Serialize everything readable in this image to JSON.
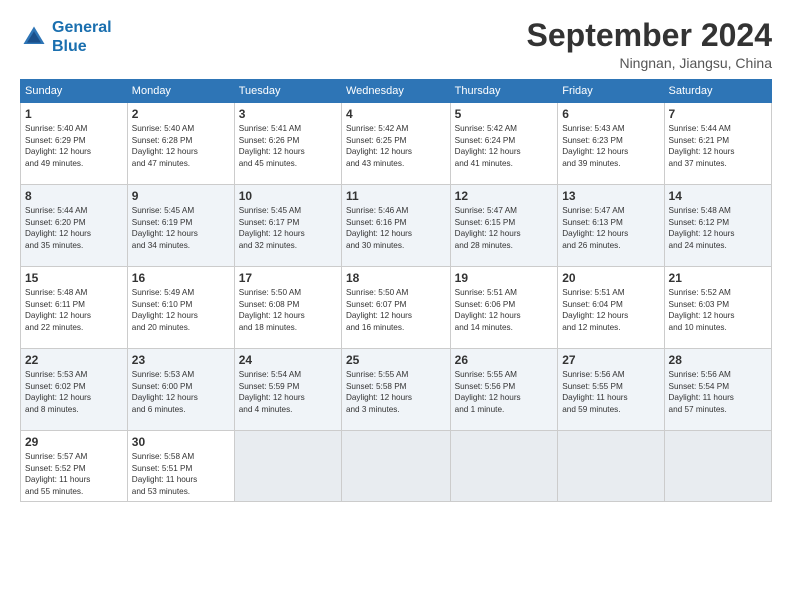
{
  "header": {
    "logo_line1": "General",
    "logo_line2": "Blue",
    "month_title": "September 2024",
    "location": "Ningnan, Jiangsu, China"
  },
  "weekdays": [
    "Sunday",
    "Monday",
    "Tuesday",
    "Wednesday",
    "Thursday",
    "Friday",
    "Saturday"
  ],
  "weeks": [
    [
      {
        "day": "1",
        "info": "Sunrise: 5:40 AM\nSunset: 6:29 PM\nDaylight: 12 hours\nand 49 minutes."
      },
      {
        "day": "2",
        "info": "Sunrise: 5:40 AM\nSunset: 6:28 PM\nDaylight: 12 hours\nand 47 minutes."
      },
      {
        "day": "3",
        "info": "Sunrise: 5:41 AM\nSunset: 6:26 PM\nDaylight: 12 hours\nand 45 minutes."
      },
      {
        "day": "4",
        "info": "Sunrise: 5:42 AM\nSunset: 6:25 PM\nDaylight: 12 hours\nand 43 minutes."
      },
      {
        "day": "5",
        "info": "Sunrise: 5:42 AM\nSunset: 6:24 PM\nDaylight: 12 hours\nand 41 minutes."
      },
      {
        "day": "6",
        "info": "Sunrise: 5:43 AM\nSunset: 6:23 PM\nDaylight: 12 hours\nand 39 minutes."
      },
      {
        "day": "7",
        "info": "Sunrise: 5:44 AM\nSunset: 6:21 PM\nDaylight: 12 hours\nand 37 minutes."
      }
    ],
    [
      {
        "day": "8",
        "info": "Sunrise: 5:44 AM\nSunset: 6:20 PM\nDaylight: 12 hours\nand 35 minutes."
      },
      {
        "day": "9",
        "info": "Sunrise: 5:45 AM\nSunset: 6:19 PM\nDaylight: 12 hours\nand 34 minutes."
      },
      {
        "day": "10",
        "info": "Sunrise: 5:45 AM\nSunset: 6:17 PM\nDaylight: 12 hours\nand 32 minutes."
      },
      {
        "day": "11",
        "info": "Sunrise: 5:46 AM\nSunset: 6:16 PM\nDaylight: 12 hours\nand 30 minutes."
      },
      {
        "day": "12",
        "info": "Sunrise: 5:47 AM\nSunset: 6:15 PM\nDaylight: 12 hours\nand 28 minutes."
      },
      {
        "day": "13",
        "info": "Sunrise: 5:47 AM\nSunset: 6:13 PM\nDaylight: 12 hours\nand 26 minutes."
      },
      {
        "day": "14",
        "info": "Sunrise: 5:48 AM\nSunset: 6:12 PM\nDaylight: 12 hours\nand 24 minutes."
      }
    ],
    [
      {
        "day": "15",
        "info": "Sunrise: 5:48 AM\nSunset: 6:11 PM\nDaylight: 12 hours\nand 22 minutes."
      },
      {
        "day": "16",
        "info": "Sunrise: 5:49 AM\nSunset: 6:10 PM\nDaylight: 12 hours\nand 20 minutes."
      },
      {
        "day": "17",
        "info": "Sunrise: 5:50 AM\nSunset: 6:08 PM\nDaylight: 12 hours\nand 18 minutes."
      },
      {
        "day": "18",
        "info": "Sunrise: 5:50 AM\nSunset: 6:07 PM\nDaylight: 12 hours\nand 16 minutes."
      },
      {
        "day": "19",
        "info": "Sunrise: 5:51 AM\nSunset: 6:06 PM\nDaylight: 12 hours\nand 14 minutes."
      },
      {
        "day": "20",
        "info": "Sunrise: 5:51 AM\nSunset: 6:04 PM\nDaylight: 12 hours\nand 12 minutes."
      },
      {
        "day": "21",
        "info": "Sunrise: 5:52 AM\nSunset: 6:03 PM\nDaylight: 12 hours\nand 10 minutes."
      }
    ],
    [
      {
        "day": "22",
        "info": "Sunrise: 5:53 AM\nSunset: 6:02 PM\nDaylight: 12 hours\nand 8 minutes."
      },
      {
        "day": "23",
        "info": "Sunrise: 5:53 AM\nSunset: 6:00 PM\nDaylight: 12 hours\nand 6 minutes."
      },
      {
        "day": "24",
        "info": "Sunrise: 5:54 AM\nSunset: 5:59 PM\nDaylight: 12 hours\nand 4 minutes."
      },
      {
        "day": "25",
        "info": "Sunrise: 5:55 AM\nSunset: 5:58 PM\nDaylight: 12 hours\nand 3 minutes."
      },
      {
        "day": "26",
        "info": "Sunrise: 5:55 AM\nSunset: 5:56 PM\nDaylight: 12 hours\nand 1 minute."
      },
      {
        "day": "27",
        "info": "Sunrise: 5:56 AM\nSunset: 5:55 PM\nDaylight: 11 hours\nand 59 minutes."
      },
      {
        "day": "28",
        "info": "Sunrise: 5:56 AM\nSunset: 5:54 PM\nDaylight: 11 hours\nand 57 minutes."
      }
    ],
    [
      {
        "day": "29",
        "info": "Sunrise: 5:57 AM\nSunset: 5:52 PM\nDaylight: 11 hours\nand 55 minutes."
      },
      {
        "day": "30",
        "info": "Sunrise: 5:58 AM\nSunset: 5:51 PM\nDaylight: 11 hours\nand 53 minutes."
      },
      {
        "day": "",
        "info": ""
      },
      {
        "day": "",
        "info": ""
      },
      {
        "day": "",
        "info": ""
      },
      {
        "day": "",
        "info": ""
      },
      {
        "day": "",
        "info": ""
      }
    ]
  ]
}
